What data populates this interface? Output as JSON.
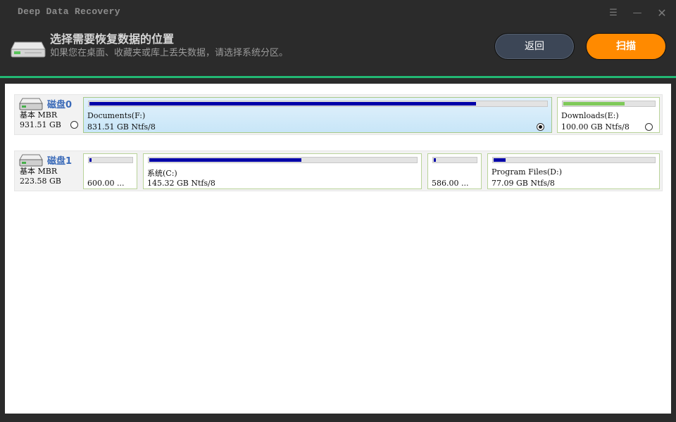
{
  "app": {
    "title": "Deep Data Recovery"
  },
  "window_controls": {
    "menu": "☰",
    "minimize": "—",
    "close": "✕"
  },
  "header": {
    "title": "选择需要恢复数据的位置",
    "subtitle": "如果您在桌面、收藏夹或库上丢失数据，请选择系统分区。",
    "back_label": "返回",
    "scan_label": "扫描"
  },
  "colors": {
    "accent": "#22b873",
    "scan_button": "#ff8a00",
    "bar_fill": "#0000a8",
    "bar_fill_alt": "#7fc95a"
  },
  "disks": [
    {
      "name": "磁盘0",
      "type": "基本 MBR",
      "size": "931.51 GB",
      "selected": false,
      "partitions": [
        {
          "label": "Documents(F:)",
          "size": "831.51 GB Ntfs/8",
          "used": 0.85,
          "selected": true
        },
        {
          "label": "Downloads(E:)",
          "size": "100.00 GB Ntfs/8",
          "used": 0.67,
          "selected": false
        }
      ]
    },
    {
      "name": "磁盘1",
      "type": "基本 MBR",
      "size": "223.58 GB",
      "partitions": [
        {
          "label": "",
          "size": "600.00 ...",
          "used": 0.06
        },
        {
          "label": "系统(C:)",
          "size": "145.32 GB Ntfs/8",
          "used": 0.56
        },
        {
          "label": "",
          "size": "586.00 ...",
          "used": 0.08
        },
        {
          "label": "Program Files(D:)",
          "size": "77.09 GB Ntfs/8",
          "used": 0.08
        }
      ]
    }
  ]
}
